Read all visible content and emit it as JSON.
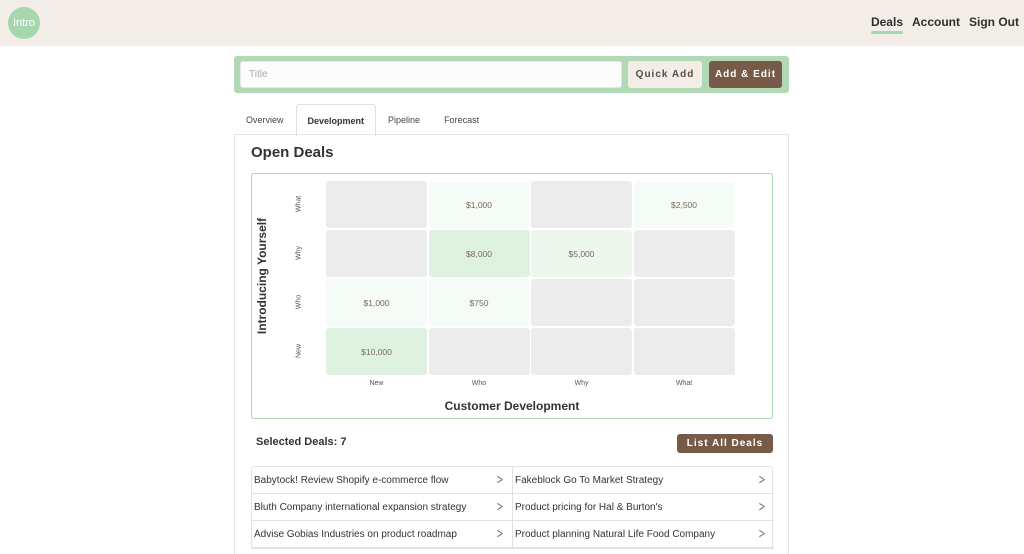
{
  "header": {
    "logo_text": "Intro",
    "nav": [
      {
        "label": "Deals",
        "active": true
      },
      {
        "label": "Account",
        "active": false
      },
      {
        "label": "Sign Out",
        "active": false
      }
    ]
  },
  "add_bar": {
    "title_placeholder": "Title",
    "title_value": "",
    "quick_add_label": "Quick Add",
    "add_edit_label": "Add & Edit"
  },
  "tabs": [
    {
      "label": "Overview",
      "active": false
    },
    {
      "label": "Development",
      "active": true
    },
    {
      "label": "Pipeline",
      "active": false
    },
    {
      "label": "Forecast",
      "active": false
    }
  ],
  "panel": {
    "title": "Open Deals"
  },
  "matrix": {
    "y_title": "Introducing Yourself",
    "x_title": "Customer Development",
    "rows": [
      "What",
      "Why",
      "Who",
      "New"
    ],
    "cols": [
      "New",
      "Who",
      "Why",
      "What"
    ],
    "cells": [
      [
        "",
        "$1,000",
        "",
        "$2,500"
      ],
      [
        "",
        "$8,000",
        "$5,000",
        ""
      ],
      [
        "$1,000",
        "$750",
        "",
        ""
      ],
      [
        "$10,000",
        "",
        "",
        ""
      ]
    ],
    "values": [
      [
        0,
        1000,
        0,
        2500
      ],
      [
        0,
        8000,
        5000,
        0
      ],
      [
        1000,
        750,
        0,
        0
      ],
      [
        10000,
        0,
        0,
        0
      ]
    ],
    "colors": {
      "empty": "#ececec",
      "low": "#f5fbf6",
      "mid": "#edf7ee",
      "high": "#dff1e1"
    }
  },
  "selection": {
    "label": "Selected Deals: 7",
    "list_all_label": "List All Deals"
  },
  "deals": [
    "Babytock! Review Shopify e-commerce flow",
    "Fakeblock Go To Market Strategy",
    "Bluth Company international expansion strategy",
    "Product pricing for Hal & Burton's",
    "Advise Gobias Industries on product roadmap",
    "Product planning Natural Life Food Company"
  ],
  "icons": {
    "chevron": "chevron-right-icon"
  }
}
